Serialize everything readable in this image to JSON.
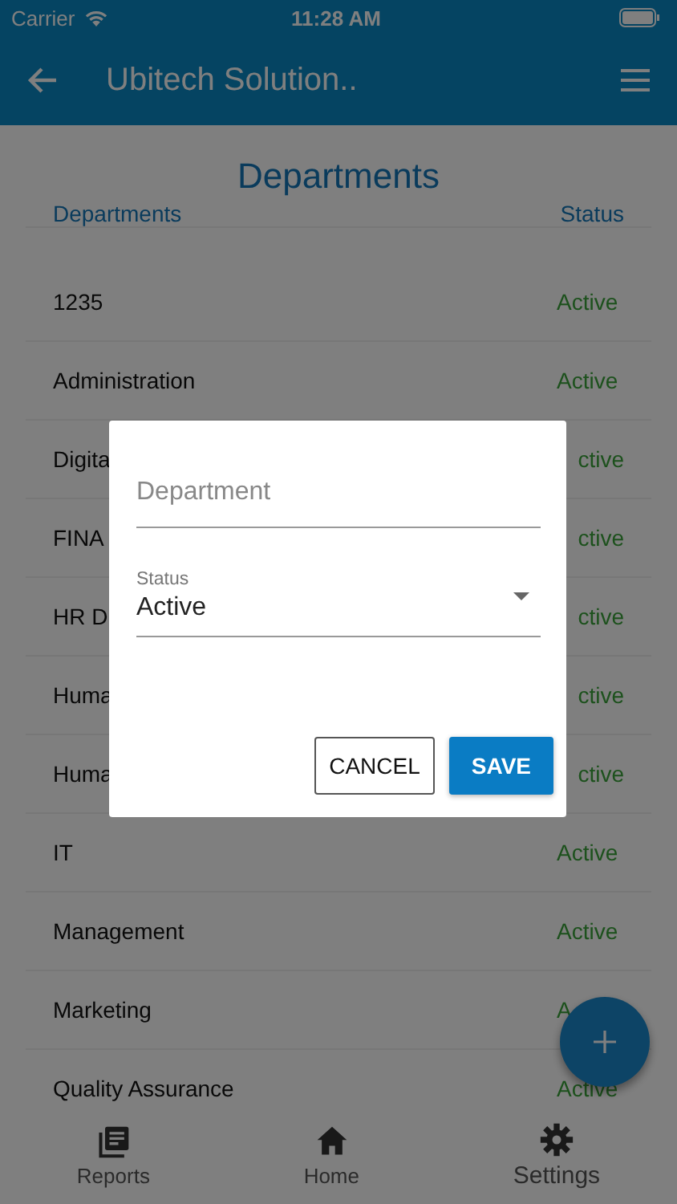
{
  "status_bar": {
    "carrier": "Carrier",
    "time": "11:28 AM"
  },
  "app_bar": {
    "title": "Ubitech Solution.."
  },
  "page_title": "Departments",
  "table": {
    "columns": [
      "Departments",
      "Status"
    ],
    "rows": [
      {
        "department": "1235",
        "status": "Active"
      },
      {
        "department": "Administration",
        "status": "Active"
      },
      {
        "department": "Digita",
        "status": "ctive",
        "clipped_left": true
      },
      {
        "department": "FINA",
        "status": "ctive",
        "clipped_left": true
      },
      {
        "department": "HR D",
        "status": "ctive",
        "clipped_left": true
      },
      {
        "department": "Huma",
        "status": "ctive",
        "clipped_left": true
      },
      {
        "department": "Huma",
        "status": "ctive",
        "clipped_left": true
      },
      {
        "department": "IT",
        "status": "Active"
      },
      {
        "department": "Management",
        "status": "Active"
      },
      {
        "department": "Marketing",
        "status": "A"
      },
      {
        "department": "Quality Assurance",
        "status": "Active"
      }
    ]
  },
  "dialog": {
    "fields": [
      {
        "kind": "text",
        "placeholder": "Department"
      },
      {
        "kind": "select",
        "label": "Status",
        "value": "Active"
      }
    ],
    "buttons": [
      {
        "kind": "outlined",
        "label": "CANCEL"
      },
      {
        "kind": "filled",
        "label": "SAVE"
      }
    ]
  },
  "bottom_nav": [
    {
      "kind": "reports",
      "label": "Reports"
    },
    {
      "kind": "home",
      "label": "Home"
    },
    {
      "kind": "settings",
      "label": "Settings"
    }
  ]
}
